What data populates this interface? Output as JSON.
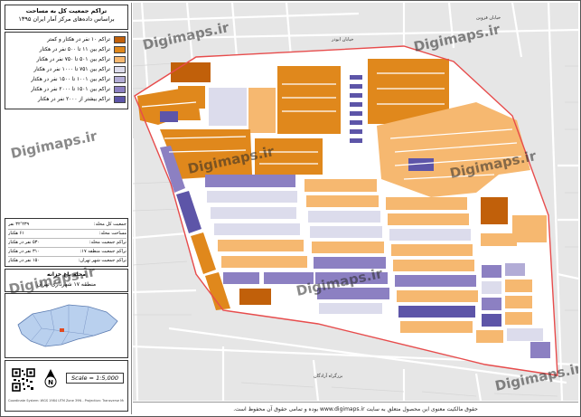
{
  "colors": {
    "c1": "#c1600a",
    "c2": "#e0881c",
    "c3": "#f6b870",
    "c4": "#dcdcec",
    "c5": "#b2acd6",
    "c6": "#8c80c2",
    "c7": "#5d55a8",
    "boundary": "#e74c4c",
    "background_map": "#e9e9e9",
    "street": "#ffffff"
  },
  "title": {
    "line1": "تراکم جمعیت کل به مساحت",
    "line2": "براساس داده‌های مرکز آمار ایران ۱۳۹۵"
  },
  "legend": [
    {
      "label": "تراکم ۱۰ نفر در هکتار و کمتر",
      "color_key": "c1"
    },
    {
      "label": "تراکم بین ۱۱ تا ۵۰۰ نفر در هکتار",
      "color_key": "c2"
    },
    {
      "label": "تراکم بین ۵۰۱ تا ۷۵۰ نفر در هکتار",
      "color_key": "c3"
    },
    {
      "label": "تراکم بین ۷۵۱ تا ۱۰۰۰ نفر در هکتار",
      "color_key": "c4"
    },
    {
      "label": "تراکم بین ۱۰۰۱ تا ۱۵۰۰ نفر در هکتار",
      "color_key": "c5"
    },
    {
      "label": "تراکم بین ۱۵۰۱ تا ۲۰۰۰ نفر در هکتار",
      "color_key": "c6"
    },
    {
      "label": "تراکم بیشتر از ۲۰۰۰ نفر در هکتار",
      "color_key": "c7"
    }
  ],
  "stats": [
    {
      "label": "جمعیت کل محله:",
      "value": "۳۲٬۲۳۹ نفر"
    },
    {
      "label": "مساحت محله:",
      "value": "۶۱ هکتار"
    },
    {
      "label": "تراکم جمعیت محله:",
      "value": "۵۳۰ نفر در هکتار"
    },
    {
      "label": "تراکم جمعیت منطقه ۱۷:",
      "value": "۳۱۰ نفر در هکتار"
    },
    {
      "label": "تراکم جمعیت شهر تهران:",
      "value": "۱۵۰ نفر در هکتار"
    }
  ],
  "area": {
    "neighborhood": "محله باغ خزانه",
    "district": "منطقه ۱۷ شهرداری تهران"
  },
  "scale_text": "Scale = 1:5,000",
  "north_label": "N",
  "watermark": "Digimaps.ir",
  "footer": "حقوق مالکیت معنوی این محصول متعلق به سایت www.digimaps.ir بوده و تمامی حقوق آن محفوظ است.",
  "tiny_text": "Coordinate System: WGS 1984 UTM Zone 39N - Projection: Transverse Mercator",
  "streets": [
    {
      "name": "خیابان ابوذر"
    },
    {
      "name": "خیابان قزوین"
    },
    {
      "name": "بزرگراه آزادگان"
    }
  ]
}
